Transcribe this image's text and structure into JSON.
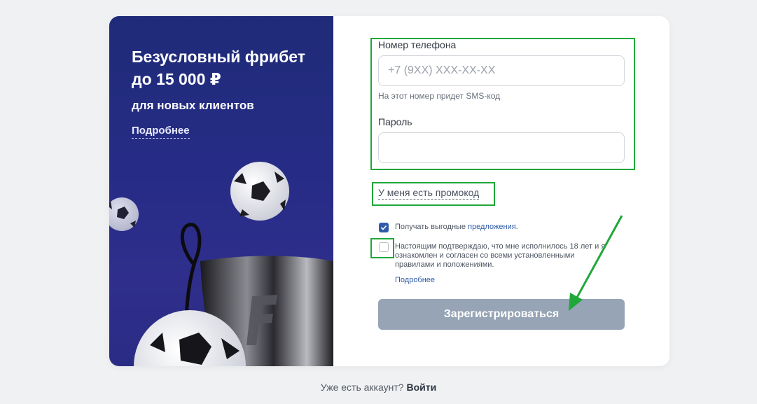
{
  "promo": {
    "title": "Безусловный фрибет до 15 000 ₽",
    "subtitle": "для новых клиентов",
    "more_link": "Подробнее"
  },
  "form": {
    "phone": {
      "label": "Номер телефона",
      "placeholder": "+7 (9XX) XXX-XX-XX",
      "value": "",
      "hint": "На этот номер придет SMS-код"
    },
    "password": {
      "label": "Пароль",
      "value": ""
    },
    "promo_code_link": "У меня есть промокод",
    "offers_checkbox": {
      "checked": true,
      "text": "Получать выгодные ",
      "link": "предложения",
      "suffix": "."
    },
    "terms_checkbox": {
      "checked": false,
      "text": "Настоящим подтверждаю, что мне исполнилось 18 лет и я ознакомлен и согласен со всеми установленными правилами и положениями.",
      "more_link": "Подробнее"
    },
    "submit_label": "Зарегистрироваться"
  },
  "footer": {
    "text": "Уже есть аккаунт?",
    "login_link": "Войти"
  },
  "colors": {
    "promo_bg": "#262c86",
    "accent": "#2f5ca8",
    "submit_disabled": "#96a4b5",
    "annotation": "#1fa83a"
  },
  "icons": [
    "soccer-ball-icon",
    "trophy-cup-icon",
    "checkmark-icon",
    "arrow-icon"
  ]
}
